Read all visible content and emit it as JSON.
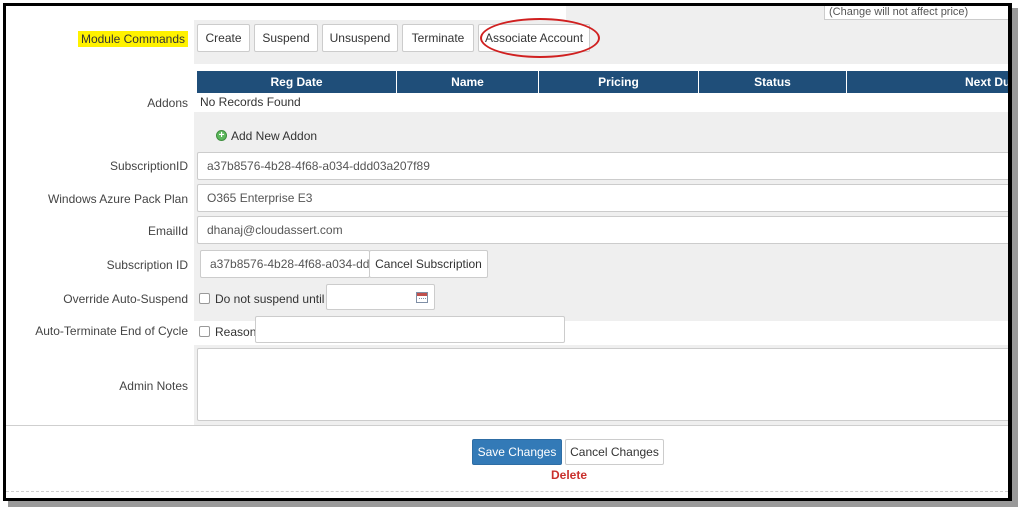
{
  "top_note": "(Change will not affect price)",
  "module_commands": {
    "label": "Module Commands",
    "buttons": [
      "Create",
      "Suspend",
      "Unsuspend",
      "Terminate",
      "Associate Account"
    ]
  },
  "addons": {
    "label": "Addons",
    "columns": [
      "Reg Date",
      "Name",
      "Pricing",
      "Status",
      "Next Du"
    ],
    "empty_text": "No Records Found",
    "add_link": "Add New Addon"
  },
  "fields": {
    "subscription_id_label": "SubscriptionID",
    "subscription_id_value": "a37b8576-4b28-4f68-a034-ddd03a207f89",
    "plan_label": "Windows Azure Pack Plan",
    "plan_value": "O365 Enterprise E3",
    "email_label": "EmailId",
    "email_value": "dhanaj@cloudassert.com",
    "subscription_id2_label": "Subscription ID",
    "subscription_id2_value": "a37b8576-4b28-4f68-a034-dd",
    "cancel_subscription": "Cancel Subscription",
    "override_label": "Override Auto-Suspend",
    "override_checkbox_label": "Do not suspend until",
    "override_date_value": "",
    "auto_terminate_label": "Auto-Terminate End of Cycle",
    "reason_label": "Reason",
    "reason_value": "",
    "admin_notes_label": "Admin Notes",
    "admin_notes_value": ""
  },
  "footer": {
    "save": "Save Changes",
    "cancel": "Cancel Changes",
    "delete": "Delete"
  },
  "colors": {
    "header_bg": "#1f4e79",
    "primary": "#337ab7",
    "delete": "#c9302c",
    "highlight": "#fff200",
    "annotation": "#d02020"
  }
}
